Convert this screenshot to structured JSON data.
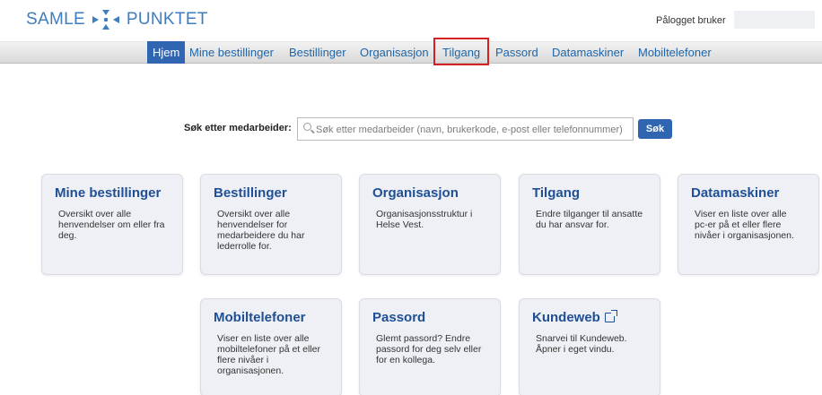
{
  "header": {
    "logo_left": "SAMLE",
    "logo_right": "PUNKTET",
    "user_label": "Pålogget bruker"
  },
  "nav": {
    "items": [
      {
        "label": "Hjem",
        "active": true
      },
      {
        "label": "Mine bestillinger"
      },
      {
        "label": "Bestillinger"
      },
      {
        "label": "Organisasjon"
      },
      {
        "label": "Tilgang",
        "highlighted": true
      },
      {
        "label": "Passord"
      },
      {
        "label": "Datamaskiner"
      },
      {
        "label": "Mobiltelefoner"
      }
    ]
  },
  "search": {
    "label": "Søk etter medarbeider:",
    "placeholder": "Søk etter medarbeider (navn, brukerkode, e-post eller telefonnummer)",
    "button": "Søk"
  },
  "cards": [
    {
      "title": "Mine bestillinger",
      "desc": "Oversikt over alle henvendelser om eller fra deg."
    },
    {
      "title": "Bestillinger",
      "desc": "Oversikt over alle henvendelser for medarbeidere du har lederrolle for."
    },
    {
      "title": "Organisasjon",
      "desc": "Organisasjonsstruktur i Helse Vest."
    },
    {
      "title": "Tilgang",
      "desc": "Endre tilganger til ansatte du har ansvar for."
    },
    {
      "title": "Datamaskiner",
      "desc": "Viser en liste over alle pc-er på et eller flere nivåer i organisasjonen."
    },
    {
      "title": "Mobiltelefoner",
      "desc": "Viser en liste over alle mobiltelefoner på et eller flere nivåer i organisasjonen."
    },
    {
      "title": "Passord",
      "desc": "Glemt passord? Endre passord for deg selv eller for en kollega."
    },
    {
      "title": "Kundeweb",
      "desc": "Snarvei til Kundeweb. Åpner i eget vindu."
    }
  ],
  "colors": {
    "accent": "#2f65b1",
    "link": "#2166a8",
    "card_title": "#1f4f94",
    "highlight_border": "#d42020"
  },
  "icons": {
    "logo": "arrows-cross-icon",
    "search": "search-icon",
    "external": "external-link-icon"
  }
}
